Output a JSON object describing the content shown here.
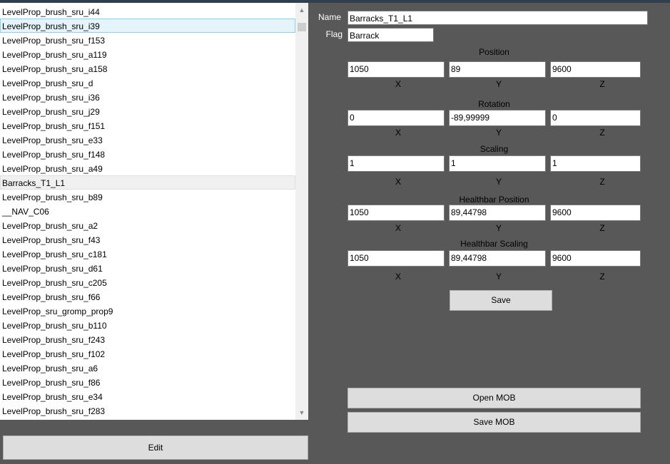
{
  "list": {
    "items": [
      "LevelProp_brush_sru_i44",
      "LevelProp_brush_sru_i39",
      "LevelProp_brush_sru_f153",
      "LevelProp_brush_sru_a119",
      "LevelProp_brush_sru_a158",
      "LevelProp_brush_sru_d",
      "LevelProp_brush_sru_i36",
      "LevelProp_brush_sru_j29",
      "LevelProp_brush_sru_f151",
      "LevelProp_brush_sru_e33",
      "LevelProp_brush_sru_f148",
      "LevelProp_brush_sru_a49",
      "Barracks_T1_L1",
      "LevelProp_brush_sru_b89",
      "__NAV_C06",
      "LevelProp_brush_sru_a2",
      "LevelProp_brush_sru_f43",
      "LevelProp_brush_sru_c181",
      "LevelProp_brush_sru_d61",
      "LevelProp_brush_sru_c205",
      "LevelProp_brush_sru_f66",
      "LevelProp_sru_gromp_prop9",
      "LevelProp_brush_sru_b110",
      "LevelProp_brush_sru_f243",
      "LevelProp_brush_sru_f102",
      "LevelProp_brush_sru_a6",
      "LevelProp_brush_sru_f86",
      "LevelProp_brush_sru_e34",
      "LevelProp_brush_sru_f283"
    ]
  },
  "edit_button": "Edit",
  "form": {
    "name_label": "Name",
    "name_value": "Barracks_T1_L1",
    "flag_label": "Flag",
    "flag_value": "Barrack",
    "axes": [
      "X",
      "Y",
      "Z"
    ],
    "position": {
      "title": "Position",
      "x": "1050",
      "y": "89",
      "z": "9600"
    },
    "rotation": {
      "title": "Rotation",
      "x": "0",
      "y": "-89,99999",
      "z": "0"
    },
    "scaling": {
      "title": "Scaling",
      "x": "1",
      "y": "1",
      "z": "1"
    },
    "healthbar_position": {
      "title": "Healthbar Position",
      "x": "1050",
      "y": "89,44798",
      "z": "9600"
    },
    "healthbar_scaling": {
      "title": "Healthbar Scaling",
      "x": "1050",
      "y": "89,44798",
      "z": "9600"
    },
    "save_button": "Save",
    "open_mob_button": "Open MOB",
    "save_mob_button": "Save MOB"
  }
}
